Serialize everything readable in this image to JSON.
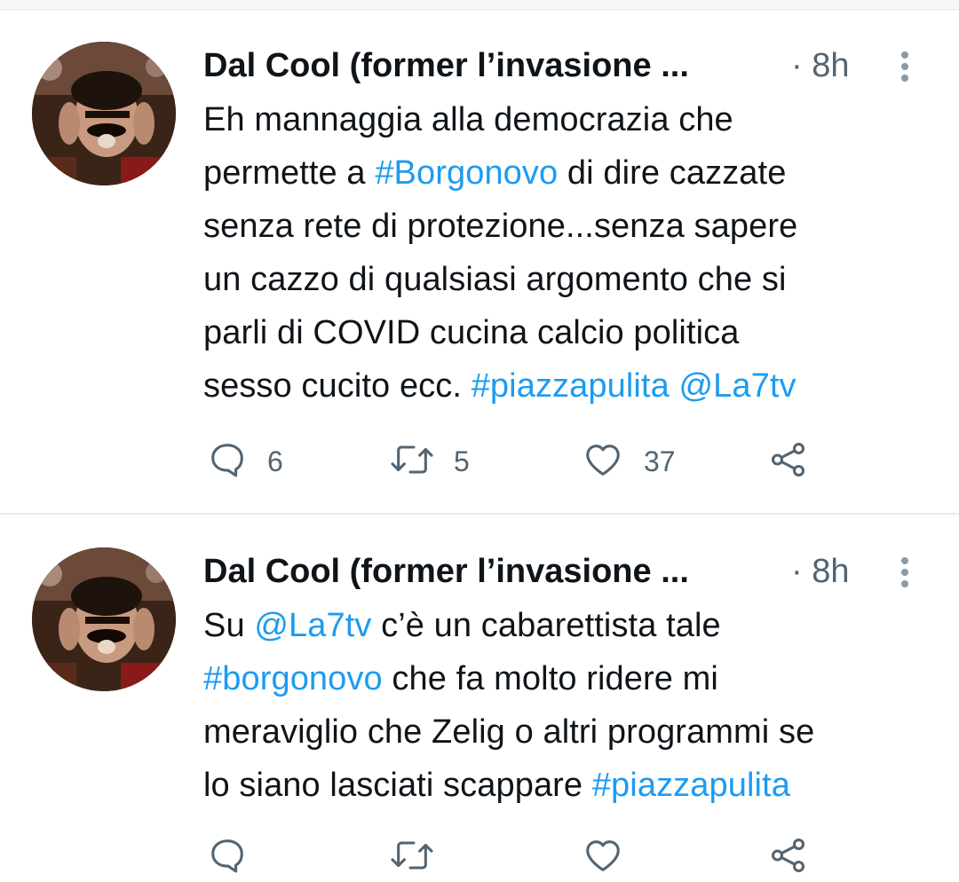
{
  "tweets": [
    {
      "author": "Dal Cool (former l’invasione ...",
      "time": "· 8h",
      "text_segments": [
        {
          "text": "Eh mannaggia alla democrazia che permette a ",
          "link": false
        },
        {
          "text": "#Borgonovo",
          "link": true
        },
        {
          "text": " di dire cazzate senza rete di protezione...senza sapere un cazzo di qualsiasi argomento che si parli di COVID cucina calcio politica sesso cucito ecc. ",
          "link": false
        },
        {
          "text": "#piazzapulita",
          "link": true
        },
        {
          "text": " ",
          "link": false
        },
        {
          "text": "@La7tv",
          "link": true
        }
      ],
      "text_lines": [
        [
          {
            "t": "Eh mannaggia alla democrazia che",
            "l": false
          }
        ],
        [
          {
            "t": "permette a ",
            "l": false
          },
          {
            "t": "#Borgonovo",
            "l": true
          },
          {
            "t": " di dire cazzate",
            "l": false
          }
        ],
        [
          {
            "t": "senza rete di protezione...senza sapere",
            "l": false
          }
        ],
        [
          {
            "t": "un cazzo di qualsiasi argomento che si",
            "l": false
          }
        ],
        [
          {
            "t": "parli di COVID cucina calcio politica",
            "l": false
          }
        ],
        [
          {
            "t": "sesso cucito ecc. ",
            "l": false
          },
          {
            "t": "#piazzapulita",
            "l": true
          },
          {
            "t": " ",
            "l": false
          },
          {
            "t": "@La7tv",
            "l": true
          }
        ]
      ],
      "replies": "6",
      "retweets": "5",
      "likes": "37"
    },
    {
      "author": "Dal Cool (former l’invasione ...",
      "time": "· 8h",
      "text_lines": [
        [
          {
            "t": "Su ",
            "l": false
          },
          {
            "t": "@La7tv",
            "l": true
          },
          {
            "t": " c’è un cabarettista tale",
            "l": false
          }
        ],
        [
          {
            "t": "#borgonovo",
            "l": true
          },
          {
            "t": " che fa molto ridere mi",
            "l": false
          }
        ],
        [
          {
            "t": "meraviglio che Zelig o altri programmi se",
            "l": false
          }
        ],
        [
          {
            "t": "lo siano lasciati scappare ",
            "l": false
          },
          {
            "t": "#piazzapulita",
            "l": true
          }
        ]
      ]
    }
  ],
  "icons": {
    "reply": "reply-icon",
    "retweet": "retweet-icon",
    "like": "heart-icon",
    "share": "share-icon",
    "more": "more-vertical-icon"
  },
  "colors": {
    "link": "#1d9bf0",
    "secondary_text": "#536471",
    "primary_text": "#0f1419"
  }
}
